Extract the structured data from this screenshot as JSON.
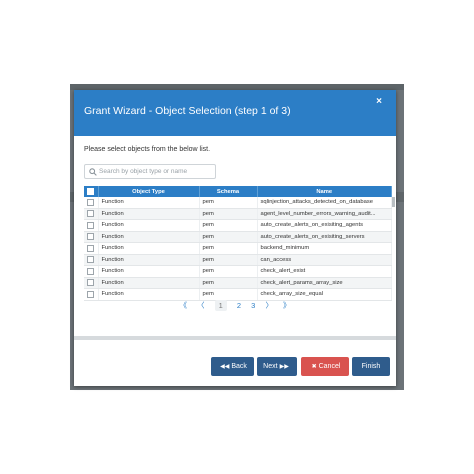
{
  "dialog": {
    "title": "Grant Wizard - Object Selection (step 1 of 3)",
    "close_glyph": "×",
    "instruction": "Please select objects from the below list.",
    "search_placeholder": "Search by object type or name"
  },
  "table": {
    "headers": [
      "Object Type",
      "Schema",
      "Name"
    ],
    "rows": [
      {
        "type": "Function",
        "schema": "pem",
        "name": "sqlinjection_attacks_detected_on_database"
      },
      {
        "type": "Function",
        "schema": "pem",
        "name": "agent_level_number_errors_warning_audit..."
      },
      {
        "type": "Function",
        "schema": "pem",
        "name": "auto_create_alerts_on_exisiting_agents"
      },
      {
        "type": "Function",
        "schema": "pem",
        "name": "auto_create_alerts_on_exisiting_servers"
      },
      {
        "type": "Function",
        "schema": "pem",
        "name": "backend_minimum"
      },
      {
        "type": "Function",
        "schema": "pem",
        "name": "can_access"
      },
      {
        "type": "Function",
        "schema": "pem",
        "name": "check_alert_exist"
      },
      {
        "type": "Function",
        "schema": "pem",
        "name": "check_alert_params_array_size"
      },
      {
        "type": "Function",
        "schema": "pem",
        "name": "check_array_size_equal"
      }
    ]
  },
  "pager": {
    "first": "《",
    "prev": "〈",
    "pages": [
      "1",
      "2",
      "3"
    ],
    "next": "〉",
    "last": "》"
  },
  "footer": {
    "back_label": "Back",
    "next_label": "Next",
    "cancel_label": "Cancel",
    "finish_label": "Finish"
  },
  "colors": {
    "header_blue": "#2c7ec6",
    "button_navy": "#2f5c8c",
    "cancel_red": "#d9534f"
  },
  "icons": {
    "search": "search-icon",
    "back": "double-chevron-left-icon",
    "next": "double-chevron-right-icon",
    "cancel": "x-icon"
  }
}
